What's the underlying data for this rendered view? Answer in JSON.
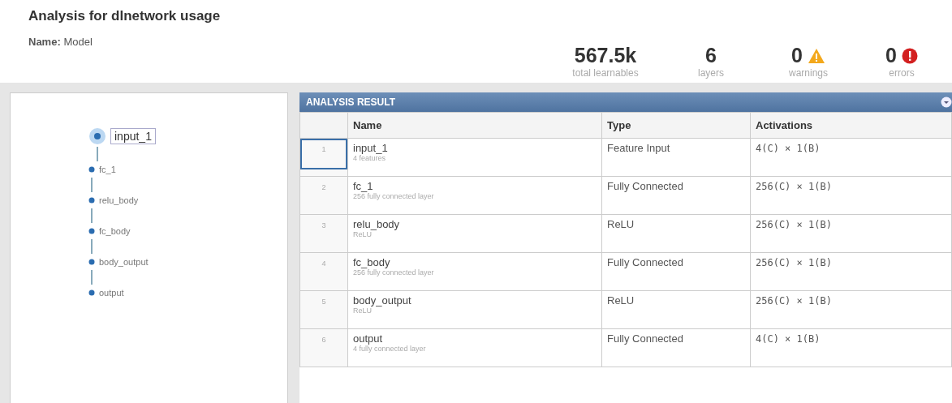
{
  "title": "Analysis for dlnetwork usage",
  "name": {
    "label": "Name:",
    "value": "Model"
  },
  "stats": [
    {
      "kind": "plain",
      "value": "567.5k",
      "label": "total learnables"
    },
    {
      "kind": "plain",
      "value": "6",
      "label": "layers"
    },
    {
      "kind": "warning",
      "value": "0",
      "label": "warnings"
    },
    {
      "kind": "error",
      "value": "0",
      "label": "errors"
    }
  ],
  "graph": {
    "nodes": [
      {
        "label": "input_1",
        "selected": true
      },
      {
        "label": "fc_1",
        "selected": false
      },
      {
        "label": "relu_body",
        "selected": false
      },
      {
        "label": "fc_body",
        "selected": false
      },
      {
        "label": "body_output",
        "selected": false
      },
      {
        "label": "output",
        "selected": false
      }
    ]
  },
  "result": {
    "title": "ANALYSIS RESULT",
    "columns": [
      "Name",
      "Type",
      "Activations"
    ],
    "rows": [
      {
        "index": "1",
        "name": "input_1",
        "detail": "4 features",
        "type": "Feature Input",
        "activations": "4(C) × 1(B)",
        "selected": true
      },
      {
        "index": "2",
        "name": "fc_1",
        "detail": "256 fully connected layer",
        "type": "Fully Connected",
        "activations": "256(C) × 1(B)",
        "selected": false
      },
      {
        "index": "3",
        "name": "relu_body",
        "detail": "ReLU",
        "type": "ReLU",
        "activations": "256(C) × 1(B)",
        "selected": false
      },
      {
        "index": "4",
        "name": "fc_body",
        "detail": "256 fully connected layer",
        "type": "Fully Connected",
        "activations": "256(C) × 1(B)",
        "selected": false
      },
      {
        "index": "5",
        "name": "body_output",
        "detail": "ReLU",
        "type": "ReLU",
        "activations": "256(C) × 1(B)",
        "selected": false
      },
      {
        "index": "6",
        "name": "output",
        "detail": "4 fully connected layer",
        "type": "Fully Connected",
        "activations": "4(C) × 1(B)",
        "selected": false
      }
    ]
  }
}
